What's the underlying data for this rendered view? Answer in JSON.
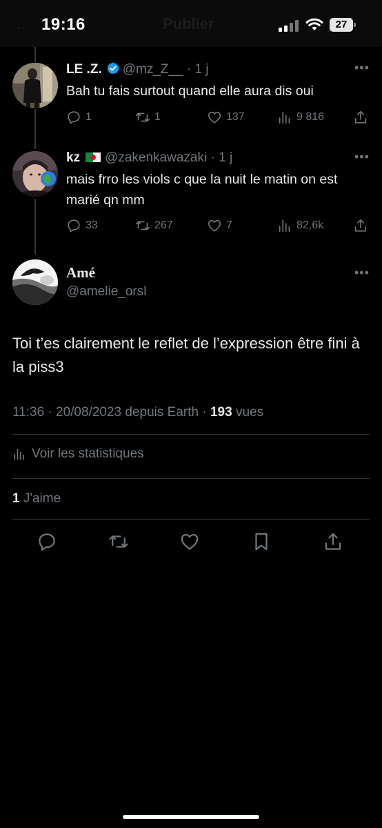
{
  "status_bar": {
    "time": "19:16",
    "battery": "27",
    "header_title": "Publier"
  },
  "replies": [
    {
      "name": "LE .Z.",
      "verified": true,
      "handle": "@mz_Z__",
      "age": "· 1 j",
      "text": "Bah tu fais surtout quand elle aura dis oui",
      "stats": {
        "replies": "1",
        "retweets": "1",
        "likes": "137",
        "views": "9 816"
      }
    },
    {
      "name": "kz",
      "flag": "algeria-flag",
      "handle": "@zakenkawazaki",
      "age": "· 1 j",
      "text": "mais frro les viols c que la nuit le matin on est marié qn mm",
      "stats": {
        "replies": "33",
        "retweets": "267",
        "likes": "7",
        "views": "82,6k"
      }
    }
  ],
  "main_tweet": {
    "name": "Amé",
    "handle": "@amelie_orsl",
    "text": "Toi t’es clairement le reflet de l’expression être fini à la piss3",
    "meta_prefix": "11:36 · 20/08/2023 depuis Earth · ",
    "views_count": "193",
    "views_label": " vues",
    "stats_link": "Voir les statistiques",
    "likes_count": "1",
    "likes_label": " J'aime"
  },
  "colors": {
    "background": "#000000",
    "text": "#e7e9ea",
    "secondary": "#71767b",
    "verified": "#1d9bf0",
    "divider": "#2f3336"
  },
  "icons": [
    "reply-icon",
    "retweet-icon",
    "like-icon",
    "views-icon",
    "share-icon",
    "bookmark-icon",
    "more-icon",
    "verified-icon"
  ]
}
